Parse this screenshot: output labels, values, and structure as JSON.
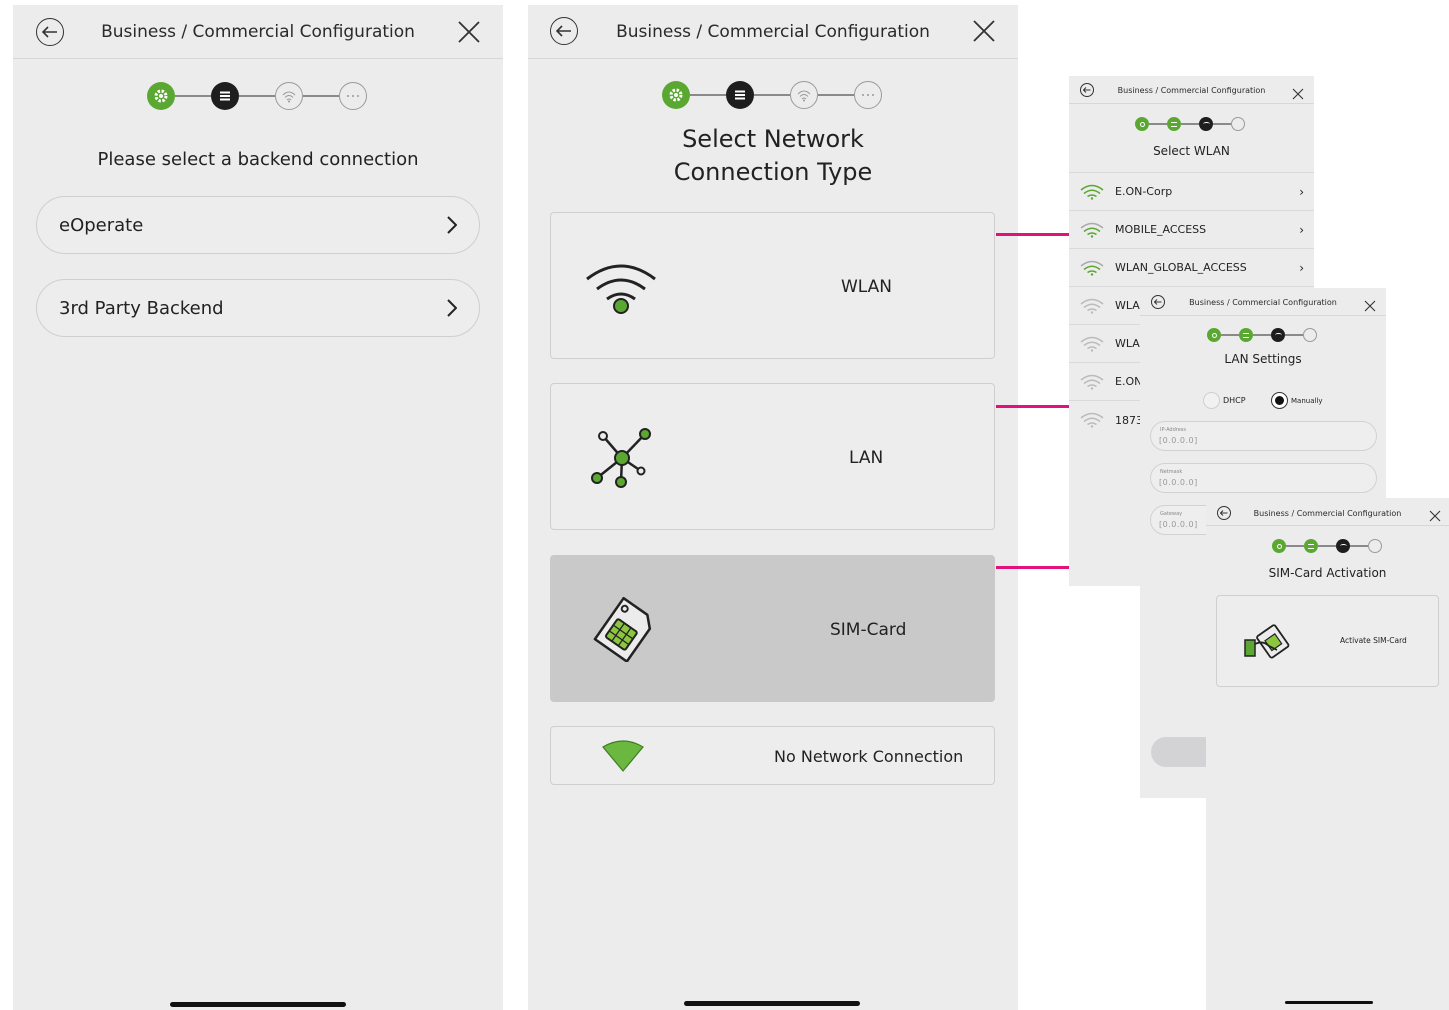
{
  "header_title": "Business / Commercial Configuration",
  "colors": {
    "accent_green": "#5aa832",
    "connector_magenta": "#e2127b",
    "active_step": "#1e1e1e"
  },
  "screen1": {
    "prompt": "Please select a backend connection",
    "options": [
      "eOperate",
      "3rd Party Backend"
    ]
  },
  "screen2": {
    "title_line1": "Select Network",
    "title_line2": "Connection Type",
    "options": [
      "WLAN",
      "LAN",
      "SIM-Card",
      "No Network Connection"
    ],
    "selected": "SIM-Card"
  },
  "screen3": {
    "title": "Select WLAN",
    "networks": [
      "E.ON-Corp",
      "MOBILE_ACCESS",
      "WLAN_GLOBAL_ACCESS",
      "WLA",
      "WLA",
      "E.ON",
      "1873"
    ]
  },
  "screen4": {
    "title": "LAN Settings",
    "radio_dhcp": "DHCP",
    "radio_manual": "Manually",
    "selected": "Manually",
    "fields": [
      {
        "label": "IP-Address",
        "value": "[0.0.0.0]"
      },
      {
        "label": "Netmask",
        "value": "[0.0.0.0]"
      },
      {
        "label": "Gateway",
        "value": "[0.0.0.0]"
      }
    ]
  },
  "screen5": {
    "title": "SIM-Card Activation",
    "action": "Activate SIM-Card"
  }
}
